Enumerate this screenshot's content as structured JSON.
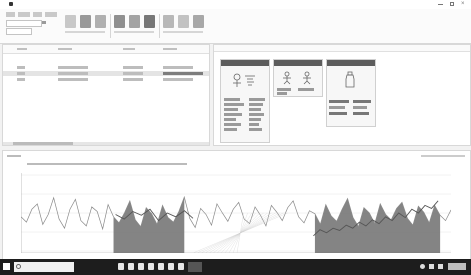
{
  "colors": {
    "taskbar": "#1d1d1d",
    "window": "#ffffff",
    "panel_header": "#5d5d5d",
    "area_fill": "#6f6f6f",
    "line": "#8a8a8a",
    "scroll": "#bbbbbb"
  },
  "icons": {
    "app": "app-logo-icon",
    "search": "search-icon",
    "windows": "windows-start-icon",
    "minimize": "minimize-icon",
    "maximize": "maximize-icon",
    "close": "close-icon"
  },
  "table_rows": [
    {
      "highlight": false
    },
    {
      "highlight": true
    },
    {
      "highlight": false
    }
  ],
  "chart_data": {
    "type": "area",
    "title": "",
    "xlabel": "",
    "ylabel": "",
    "grid": true,
    "series": [
      {
        "values": [
          0.45,
          0.38,
          0.55,
          0.62,
          0.35,
          0.48,
          0.7,
          0.42,
          0.3,
          0.55,
          0.68,
          0.4,
          0.33,
          0.58,
          0.52,
          0.29,
          0.61,
          0.45,
          0.37,
          0.5,
          0.66,
          0.41,
          0.32,
          0.57,
          0.49,
          0.35,
          0.6,
          0.44,
          0.38,
          0.52,
          0.71,
          0.43,
          0.31,
          0.56,
          0.48,
          0.34,
          0.62,
          0.5,
          0.39,
          0.55,
          0.64,
          0.42,
          0.36,
          0.58,
          0.47,
          0.33,
          0.6,
          0.51,
          0.4,
          0.57,
          0.66,
          0.45,
          0.37,
          0.53,
          0.49,
          0.35,
          0.61,
          0.46,
          0.39,
          0.55,
          0.69,
          0.44,
          0.32,
          0.57,
          0.5,
          0.36,
          0.62,
          0.48,
          0.41,
          0.56,
          0.64,
          0.43,
          0.34,
          0.59,
          0.51,
          0.37,
          0.6,
          0.47,
          0.4,
          0.54
        ]
      },
      {
        "values": [
          0.2,
          0.28,
          0.24,
          0.3,
          0.27,
          0.34,
          0.3,
          0.38,
          0.33,
          0.41,
          0.36,
          0.45,
          0.4,
          0.5,
          0.44,
          0.55,
          0.5,
          0.6,
          0.56,
          0.66
        ]
      },
      {
        "values": [
          0.48,
          0.42,
          0.52,
          0.47,
          0.55,
          0.4,
          0.5,
          0.45,
          0.53,
          0.43
        ]
      }
    ],
    "shaded_ranges": [
      [
        0.22,
        0.38
      ],
      [
        0.68,
        0.97
      ]
    ],
    "ylim": [
      0,
      1
    ]
  }
}
